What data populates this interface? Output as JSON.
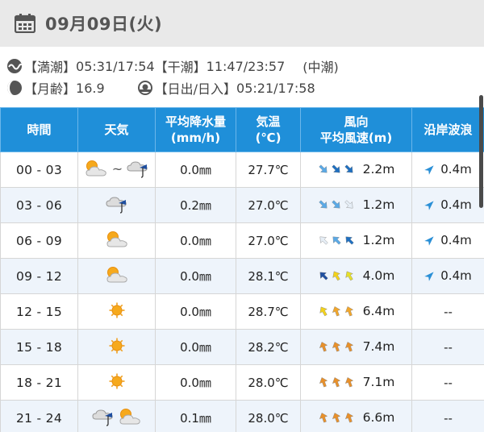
{
  "header": {
    "date": "09月09日(火)"
  },
  "tide": {
    "high_label": "【満潮】",
    "high_times": "05:31/17:54",
    "low_label": "【干潮】",
    "low_times": "11:47/23:57",
    "tide_type": "(中潮)"
  },
  "moon": {
    "label": "【月齢】",
    "value": "16.9"
  },
  "sun": {
    "label": "【日出/日入】",
    "times": "05:21/17:58"
  },
  "table": {
    "headers": {
      "time": "時間",
      "weather": "天気",
      "rain_1": "平均降水量",
      "rain_2": "(mm/h)",
      "temp_1": "気温",
      "temp_2": "(℃)",
      "wind_1": "風向",
      "wind_2": "平均風速(m)",
      "wave": "沿岸波浪"
    },
    "tilde": "~",
    "rows": [
      {
        "time": "00 - 03",
        "weather": [
          "sun-cloud",
          "rain-cloud"
        ],
        "tilde": true,
        "rain": "0.0㎜",
        "temp": "27.7℃",
        "wind": [
          135,
          135,
          135
        ],
        "wind_colors": [
          "#5aa9e6",
          "#1f6fc0",
          "#1f6fc0"
        ],
        "speed": "2.2m",
        "wave_dir": 45,
        "wave": "0.4m"
      },
      {
        "time": "03 - 06",
        "weather": [
          "rain-cloud"
        ],
        "tilde": false,
        "rain": "0.2㎜",
        "temp": "27.0℃",
        "wind": [
          135,
          135,
          135
        ],
        "wind_colors": [
          "#5aa9e6",
          "#5aa9e6",
          "#e6eef6"
        ],
        "speed": "1.2m",
        "wave_dir": 45,
        "wave": "0.4m"
      },
      {
        "time": "06 - 09",
        "weather": [
          "sun-cloud"
        ],
        "tilde": false,
        "rain": "0.0㎜",
        "temp": "27.0℃",
        "wind": [
          -45,
          -45,
          -45
        ],
        "wind_colors": [
          "#e6eef6",
          "#5aa9e6",
          "#1f6fc0"
        ],
        "speed": "1.2m",
        "wave_dir": 45,
        "wave": "0.4m"
      },
      {
        "time": "09 - 12",
        "weather": [
          "sun-cloud"
        ],
        "tilde": false,
        "rain": "0.0㎜",
        "temp": "28.1℃",
        "wind": [
          -45,
          -30,
          -30
        ],
        "wind_colors": [
          "#1f4fa0",
          "#f3d21a",
          "#e6e02a"
        ],
        "speed": "4.0m",
        "wave_dir": 45,
        "wave": "0.4m"
      },
      {
        "time": "12 - 15",
        "weather": [
          "sun"
        ],
        "tilde": false,
        "rain": "0.0㎜",
        "temp": "28.7℃",
        "wind": [
          -30,
          -20,
          -20
        ],
        "wind_colors": [
          "#f3d21a",
          "#f2a62a",
          "#f2a62a"
        ],
        "speed": "6.4m",
        "wave_dir": null,
        "wave": "--"
      },
      {
        "time": "15 - 18",
        "weather": [
          "sun"
        ],
        "tilde": false,
        "rain": "0.0㎜",
        "temp": "28.2℃",
        "wind": [
          -20,
          -20,
          -20
        ],
        "wind_colors": [
          "#e8902a",
          "#e8902a",
          "#e8902a"
        ],
        "speed": "7.4m",
        "wave_dir": null,
        "wave": "--"
      },
      {
        "time": "18 - 21",
        "weather": [
          "sun"
        ],
        "tilde": false,
        "rain": "0.0㎜",
        "temp": "28.0℃",
        "wind": [
          -20,
          -20,
          -20
        ],
        "wind_colors": [
          "#e8902a",
          "#e8902a",
          "#e8902a"
        ],
        "speed": "7.1m",
        "wave_dir": null,
        "wave": "--"
      },
      {
        "time": "21 - 24",
        "weather": [
          "rain-cloud",
          "sun-cloud"
        ],
        "tilde": false,
        "rain": "0.1㎜",
        "temp": "28.0℃",
        "wind": [
          -20,
          -20,
          -20
        ],
        "wind_colors": [
          "#e8902a",
          "#e8902a",
          "#e8902a"
        ],
        "speed": "6.6m",
        "wave_dir": null,
        "wave": "--"
      }
    ]
  },
  "colors": {
    "header_blue": "#1f8fd9",
    "wave_arrow": "#2a8fd6"
  }
}
